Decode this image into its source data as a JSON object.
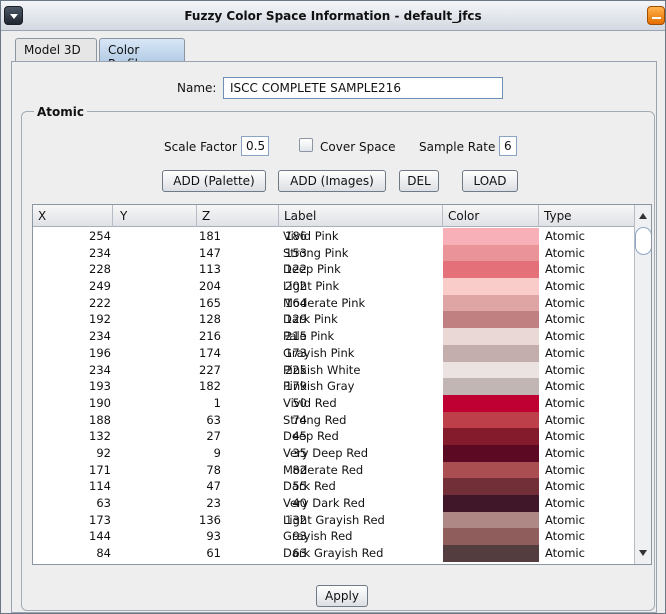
{
  "window": {
    "title": "Fuzzy Color Space Information - default_jfcs"
  },
  "tabs": [
    {
      "label": "Model 3D"
    },
    {
      "label": "Color Profile"
    }
  ],
  "name": {
    "label": "Name:",
    "value": "ISCC  COMPLETE  SAMPLE216"
  },
  "atomic": {
    "section_label": "Atomic",
    "scale_factor_label": "Scale Factor",
    "scale_factor_value": "0.5",
    "cover_space_label": "Cover Space",
    "sample_rate_label": "Sample Rate",
    "sample_rate_value": "6",
    "buttons": {
      "add_palette": "ADD (Palette)",
      "add_images": "ADD (Images)",
      "del": "DEL",
      "load": "LOAD"
    }
  },
  "table": {
    "columns": [
      "X",
      "Y",
      "Z",
      "Label",
      "Color",
      "Type"
    ],
    "rows": [
      {
        "x": "254",
        "y": "181",
        "z": "186",
        "label": "Vivid Pink",
        "color": "#f7b0b8",
        "type": "Atomic"
      },
      {
        "x": "234",
        "y": "147",
        "z": "153",
        "label": "Strong Pink",
        "color": "#ea9399",
        "type": "Atomic"
      },
      {
        "x": "228",
        "y": "113",
        "z": "122",
        "label": "Deep Pink",
        "color": "#e4717a",
        "type": "Atomic"
      },
      {
        "x": "249",
        "y": "204",
        "z": "202",
        "label": "Light Pink",
        "color": "#f9ccca",
        "type": "Atomic"
      },
      {
        "x": "222",
        "y": "165",
        "z": "164",
        "label": "Moderate Pink",
        "color": "#dea5a4",
        "type": "Atomic"
      },
      {
        "x": "192",
        "y": "128",
        "z": "129",
        "label": "Dark Pink",
        "color": "#c08081",
        "type": "Atomic"
      },
      {
        "x": "234",
        "y": "216",
        "z": "215",
        "label": "Pale Pink",
        "color": "#ead8d7",
        "type": "Atomic"
      },
      {
        "x": "196",
        "y": "174",
        "z": "173",
        "label": "Grayish Pink",
        "color": "#c4aead",
        "type": "Atomic"
      },
      {
        "x": "234",
        "y": "227",
        "z": "225",
        "label": "Pinkish White",
        "color": "#eae3e1",
        "type": "Atomic"
      },
      {
        "x": "193",
        "y": "182",
        "z": "179",
        "label": "Pinkish Gray",
        "color": "#c1b6b3",
        "type": "Atomic"
      },
      {
        "x": "190",
        "y": "1",
        "z": "50",
        "label": "Vivid Red",
        "color": "#be0132",
        "type": "Atomic"
      },
      {
        "x": "188",
        "y": "63",
        "z": "74",
        "label": "Strong Red",
        "color": "#bc3f4a",
        "type": "Atomic"
      },
      {
        "x": "132",
        "y": "27",
        "z": "45",
        "label": "Deep Red",
        "color": "#841b2d",
        "type": "Atomic"
      },
      {
        "x": "92",
        "y": "9",
        "z": "35",
        "label": "Very Deep Red",
        "color": "#5c0923",
        "type": "Atomic"
      },
      {
        "x": "171",
        "y": "78",
        "z": "82",
        "label": "Moderate Red",
        "color": "#ab4e52",
        "type": "Atomic"
      },
      {
        "x": "114",
        "y": "47",
        "z": "55",
        "label": "Dark Red",
        "color": "#722f37",
        "type": "Atomic"
      },
      {
        "x": "63",
        "y": "23",
        "z": "40",
        "label": "Very Dark Red",
        "color": "#3f1728",
        "type": "Atomic"
      },
      {
        "x": "173",
        "y": "136",
        "z": "132",
        "label": "Light Grayish Red",
        "color": "#ad8884",
        "type": "Atomic"
      },
      {
        "x": "144",
        "y": "93",
        "z": "93",
        "label": "Grayish Red",
        "color": "#905d5d",
        "type": "Atomic"
      },
      {
        "x": "84",
        "y": "61",
        "z": "63",
        "label": "Dark Grayish Red",
        "color": "#543d3f",
        "type": "Atomic"
      }
    ]
  },
  "apply_label": "Apply"
}
